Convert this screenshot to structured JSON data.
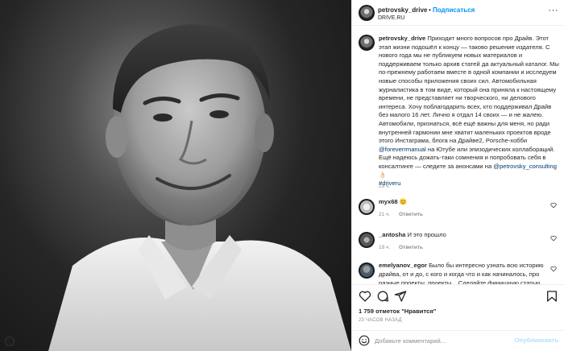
{
  "post": {
    "username": "petrovsky_drive",
    "follow_label": "Подписаться",
    "separator": "•",
    "subtitle": "DRIVE.RU",
    "more_label": "···"
  },
  "caption": {
    "username": "petrovsky_drive",
    "text_1": "Приходит много вопросов про Драйв. Этот этап жизни подошёл к концу — таково решение издателя. С нового года мы не публикуем новых материалов и поддерживаем только архив статей да актуальный каталог. Мы по-прежнему работаем вместе в одной компании и исследуем новые способы приложения своих сил. Автомобильная журналистика в том виде, который она приняла к настоящему времени, не представляет ни творческого, ни делового интереса. Хочу поблагодарить всех, кто поддерживал Драйв без малого 16 лет. Лично я отдал 14 своих — и не жалею. Автомобили, признаться, всё ещё важны для меня, но ради внутренней гармонии мне хватит маленьких проектов вроде этого Инстаграма, блога на Драйве2, Porsche-хобби",
    "mention_1": "@foreverrmanual",
    "text_2": "на Ютубе или эпизодических коллабораций. Ещё надеюсь дожать-таки сомнения и попробовать себя в консалтинге — следите за анонсами на",
    "mention_2": "@petrovsky_consulting",
    "emoji": "👌🏻",
    "hashtag": "#driveru",
    "time": "23 ч."
  },
  "comments": [
    {
      "username": "myx68",
      "text": "😊",
      "time": "21 ч.",
      "reply_label": "Ответить"
    },
    {
      "username": "_antosha",
      "text": "И это прошло",
      "time": "19 ч.",
      "reply_label": "Ответить"
    },
    {
      "username": "emelyanov_egor",
      "text": "Было бы интересно узнать всю историю драйва, от и до, с кого и когда что и как начиналось, про разные проекты, проекты... Сделайте финишную статью",
      "time": "",
      "reply_label": ""
    }
  ],
  "footer": {
    "likes": "1 759 отметок \"Нравится\"",
    "time_ago": "23 ЧАСОВ НАЗАД",
    "comment_placeholder": "Добавьте комментарий...",
    "publish_label": "Опубликовать"
  },
  "icons": {
    "heart": "heart-icon",
    "comment": "comment-icon",
    "share": "share-icon",
    "save": "bookmark-icon",
    "emoji": "emoji-icon",
    "more": "more-icon"
  },
  "colors": {
    "accent": "#0095f6",
    "link": "#00376b",
    "muted": "#8e8e8e",
    "border": "#efefef",
    "publish_disabled": "#b2dffc"
  }
}
